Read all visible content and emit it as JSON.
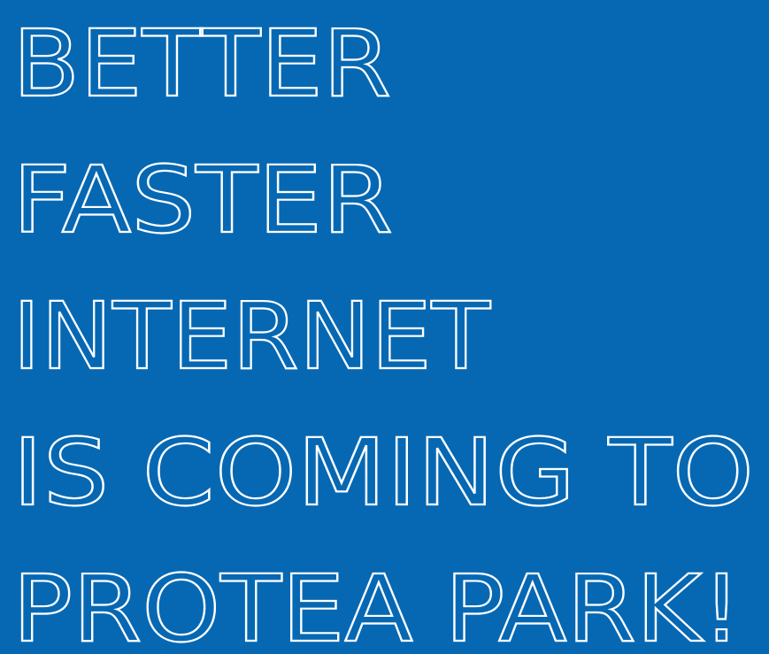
{
  "background_color": "#0668b3",
  "text_color": "#ffffff",
  "headline": {
    "line1": "BETTER",
    "line2": "FASTER",
    "line3": "INTERNET",
    "line4": "IS COMING TO",
    "line5": "PROTEA PARK!"
  }
}
